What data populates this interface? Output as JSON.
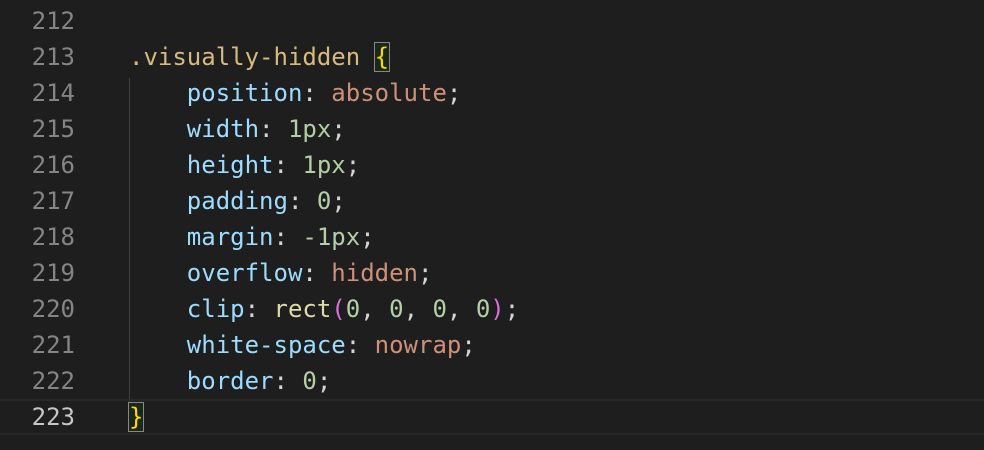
{
  "editor": {
    "lines": [
      {
        "num": "212",
        "active": false,
        "tokens": []
      },
      {
        "num": "213",
        "active": false,
        "tokens": [
          {
            "t": ".visually-hidden",
            "c": "selector"
          },
          {
            "t": " ",
            "c": "punc"
          },
          {
            "t": "{",
            "c": "brace",
            "match": true
          }
        ]
      },
      {
        "num": "214",
        "active": false,
        "tokens": [
          {
            "t": "    ",
            "c": "punc"
          },
          {
            "t": "position",
            "c": "prop"
          },
          {
            "t": ": ",
            "c": "punc"
          },
          {
            "t": "absolute",
            "c": "val"
          },
          {
            "t": ";",
            "c": "punc"
          }
        ]
      },
      {
        "num": "215",
        "active": false,
        "tokens": [
          {
            "t": "    ",
            "c": "punc"
          },
          {
            "t": "width",
            "c": "prop"
          },
          {
            "t": ": ",
            "c": "punc"
          },
          {
            "t": "1px",
            "c": "num"
          },
          {
            "t": ";",
            "c": "punc"
          }
        ]
      },
      {
        "num": "216",
        "active": false,
        "tokens": [
          {
            "t": "    ",
            "c": "punc"
          },
          {
            "t": "height",
            "c": "prop"
          },
          {
            "t": ": ",
            "c": "punc"
          },
          {
            "t": "1px",
            "c": "num"
          },
          {
            "t": ";",
            "c": "punc"
          }
        ]
      },
      {
        "num": "217",
        "active": false,
        "tokens": [
          {
            "t": "    ",
            "c": "punc"
          },
          {
            "t": "padding",
            "c": "prop"
          },
          {
            "t": ": ",
            "c": "punc"
          },
          {
            "t": "0",
            "c": "num"
          },
          {
            "t": ";",
            "c": "punc"
          }
        ]
      },
      {
        "num": "218",
        "active": false,
        "tokens": [
          {
            "t": "    ",
            "c": "punc"
          },
          {
            "t": "margin",
            "c": "prop"
          },
          {
            "t": ": ",
            "c": "punc"
          },
          {
            "t": "-1px",
            "c": "num"
          },
          {
            "t": ";",
            "c": "punc"
          }
        ]
      },
      {
        "num": "219",
        "active": false,
        "tokens": [
          {
            "t": "    ",
            "c": "punc"
          },
          {
            "t": "overflow",
            "c": "prop"
          },
          {
            "t": ": ",
            "c": "punc"
          },
          {
            "t": "hidden",
            "c": "val"
          },
          {
            "t": ";",
            "c": "punc"
          }
        ]
      },
      {
        "num": "220",
        "active": false,
        "tokens": [
          {
            "t": "    ",
            "c": "punc"
          },
          {
            "t": "clip",
            "c": "prop"
          },
          {
            "t": ": ",
            "c": "punc"
          },
          {
            "t": "rect",
            "c": "func"
          },
          {
            "t": "(",
            "c": "paren"
          },
          {
            "t": "0",
            "c": "num"
          },
          {
            "t": ", ",
            "c": "punc"
          },
          {
            "t": "0",
            "c": "num"
          },
          {
            "t": ", ",
            "c": "punc"
          },
          {
            "t": "0",
            "c": "num"
          },
          {
            "t": ", ",
            "c": "punc"
          },
          {
            "t": "0",
            "c": "num"
          },
          {
            "t": ")",
            "c": "paren"
          },
          {
            "t": ";",
            "c": "punc"
          }
        ]
      },
      {
        "num": "221",
        "active": false,
        "tokens": [
          {
            "t": "    ",
            "c": "punc"
          },
          {
            "t": "white-space",
            "c": "prop"
          },
          {
            "t": ": ",
            "c": "punc"
          },
          {
            "t": "nowrap",
            "c": "val"
          },
          {
            "t": ";",
            "c": "punc"
          }
        ]
      },
      {
        "num": "222",
        "active": false,
        "tokens": [
          {
            "t": "    ",
            "c": "punc"
          },
          {
            "t": "border",
            "c": "prop"
          },
          {
            "t": ": ",
            "c": "punc"
          },
          {
            "t": "0",
            "c": "num"
          },
          {
            "t": ";",
            "c": "punc"
          }
        ]
      },
      {
        "num": "223",
        "active": true,
        "tokens": [
          {
            "t": "}",
            "c": "brace",
            "match": true
          }
        ]
      }
    ]
  },
  "theme": {
    "background": "#1e1e1e",
    "selector": "#d7ba7d",
    "property": "#9cdcfe",
    "value": "#ce9178",
    "number": "#b5cea8",
    "brace": "#ffd700",
    "paren": "#da70d6",
    "function": "#dcdcaa"
  }
}
